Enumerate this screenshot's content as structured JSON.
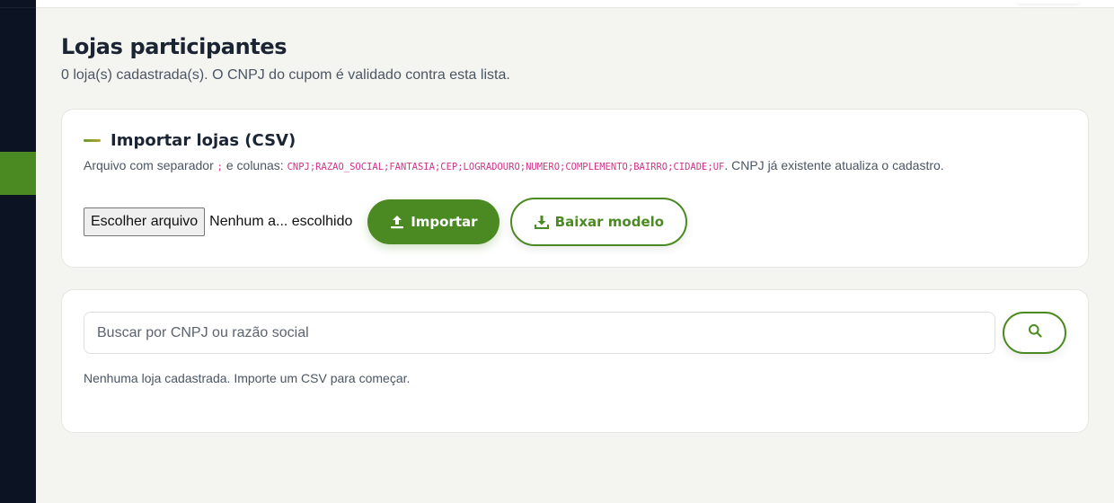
{
  "page": {
    "title": "Lojas participantes",
    "subtitle": "0 loja(s) cadastrada(s). O CNPJ do cupom é validado contra esta lista."
  },
  "import_card": {
    "title": "Importar lojas (CSV)",
    "desc_prefix": "Arquivo com separador ",
    "separator": ";",
    "desc_mid": " e colunas: ",
    "columns": "CNPJ;RAZAO_SOCIAL;FANTASIA;CEP;LOGRADOURO;NUMERO;COMPLEMENTO;BAIRRO;CIDADE;UF",
    "desc_suffix": ". CNPJ já existente atualiza o cadastro.",
    "file_button_label": "Escolher arquivo",
    "file_status": "Nenhum a... escolhido",
    "import_button_label": "Importar",
    "download_button_label": "Baixar modelo"
  },
  "search_card": {
    "placeholder": "Buscar por CNPJ ou razão social",
    "value": "",
    "empty_message": "Nenhuma loja cadastrada. Importe um CSV para começar."
  },
  "icons": {
    "import": "upload-icon",
    "download": "download-icon",
    "search": "search-icon"
  },
  "colors": {
    "brand": "#4b8a23",
    "sidebar": "#0c1322",
    "code": "#d1338a"
  }
}
